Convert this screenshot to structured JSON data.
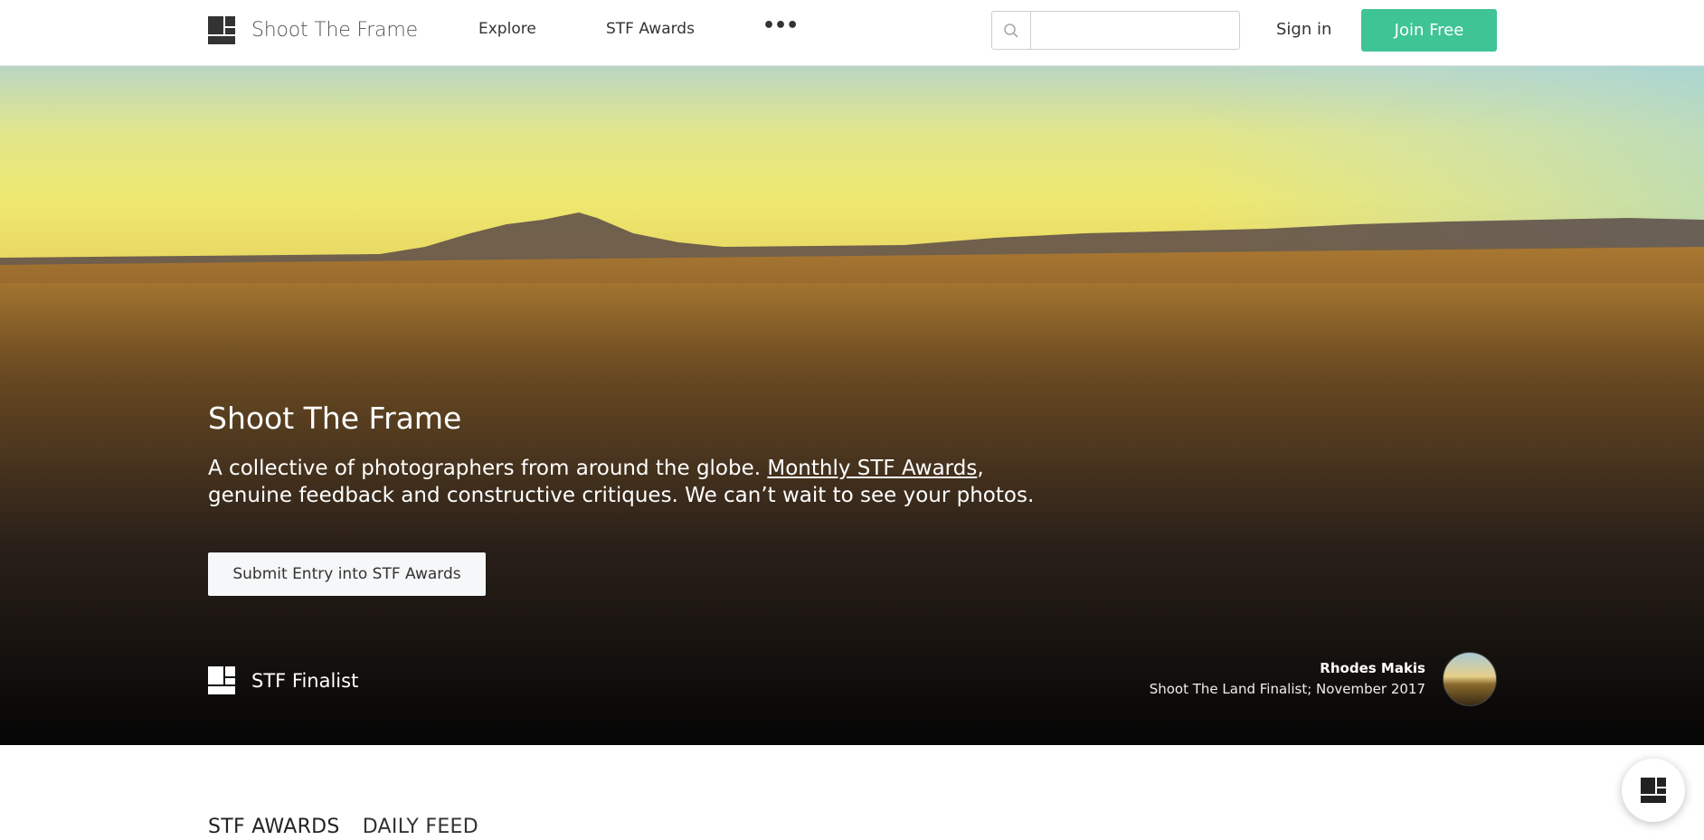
{
  "header": {
    "brand": "Shoot The Frame",
    "nav": {
      "explore": "Explore",
      "awards": "STF Awards",
      "more": "•••"
    },
    "search": {
      "value": "",
      "placeholder": ""
    },
    "signin": "Sign in",
    "join": "Join Free"
  },
  "hero": {
    "title": "Shoot The Frame",
    "desc_before": "A collective of photographers from around the globe. ",
    "desc_link": "Monthly STF Awards",
    "desc_after": ", genuine feedback and constructive critiques. We can’t wait to see your photos.",
    "submit_button": "Submit Entry into STF Awards",
    "finalist_label": "STF Finalist",
    "credit": {
      "name": "Rhodes Makis",
      "subtitle": "Shoot The Land Finalist; November 2017"
    }
  },
  "feed_tabs": [
    "STF AWARDS",
    "DAILY FEED"
  ],
  "colors": {
    "join_button": "#3fc495",
    "text_dark": "#333333"
  },
  "icons": [
    "logo-icon",
    "search-icon",
    "more-icon",
    "chat-logo-icon"
  ]
}
